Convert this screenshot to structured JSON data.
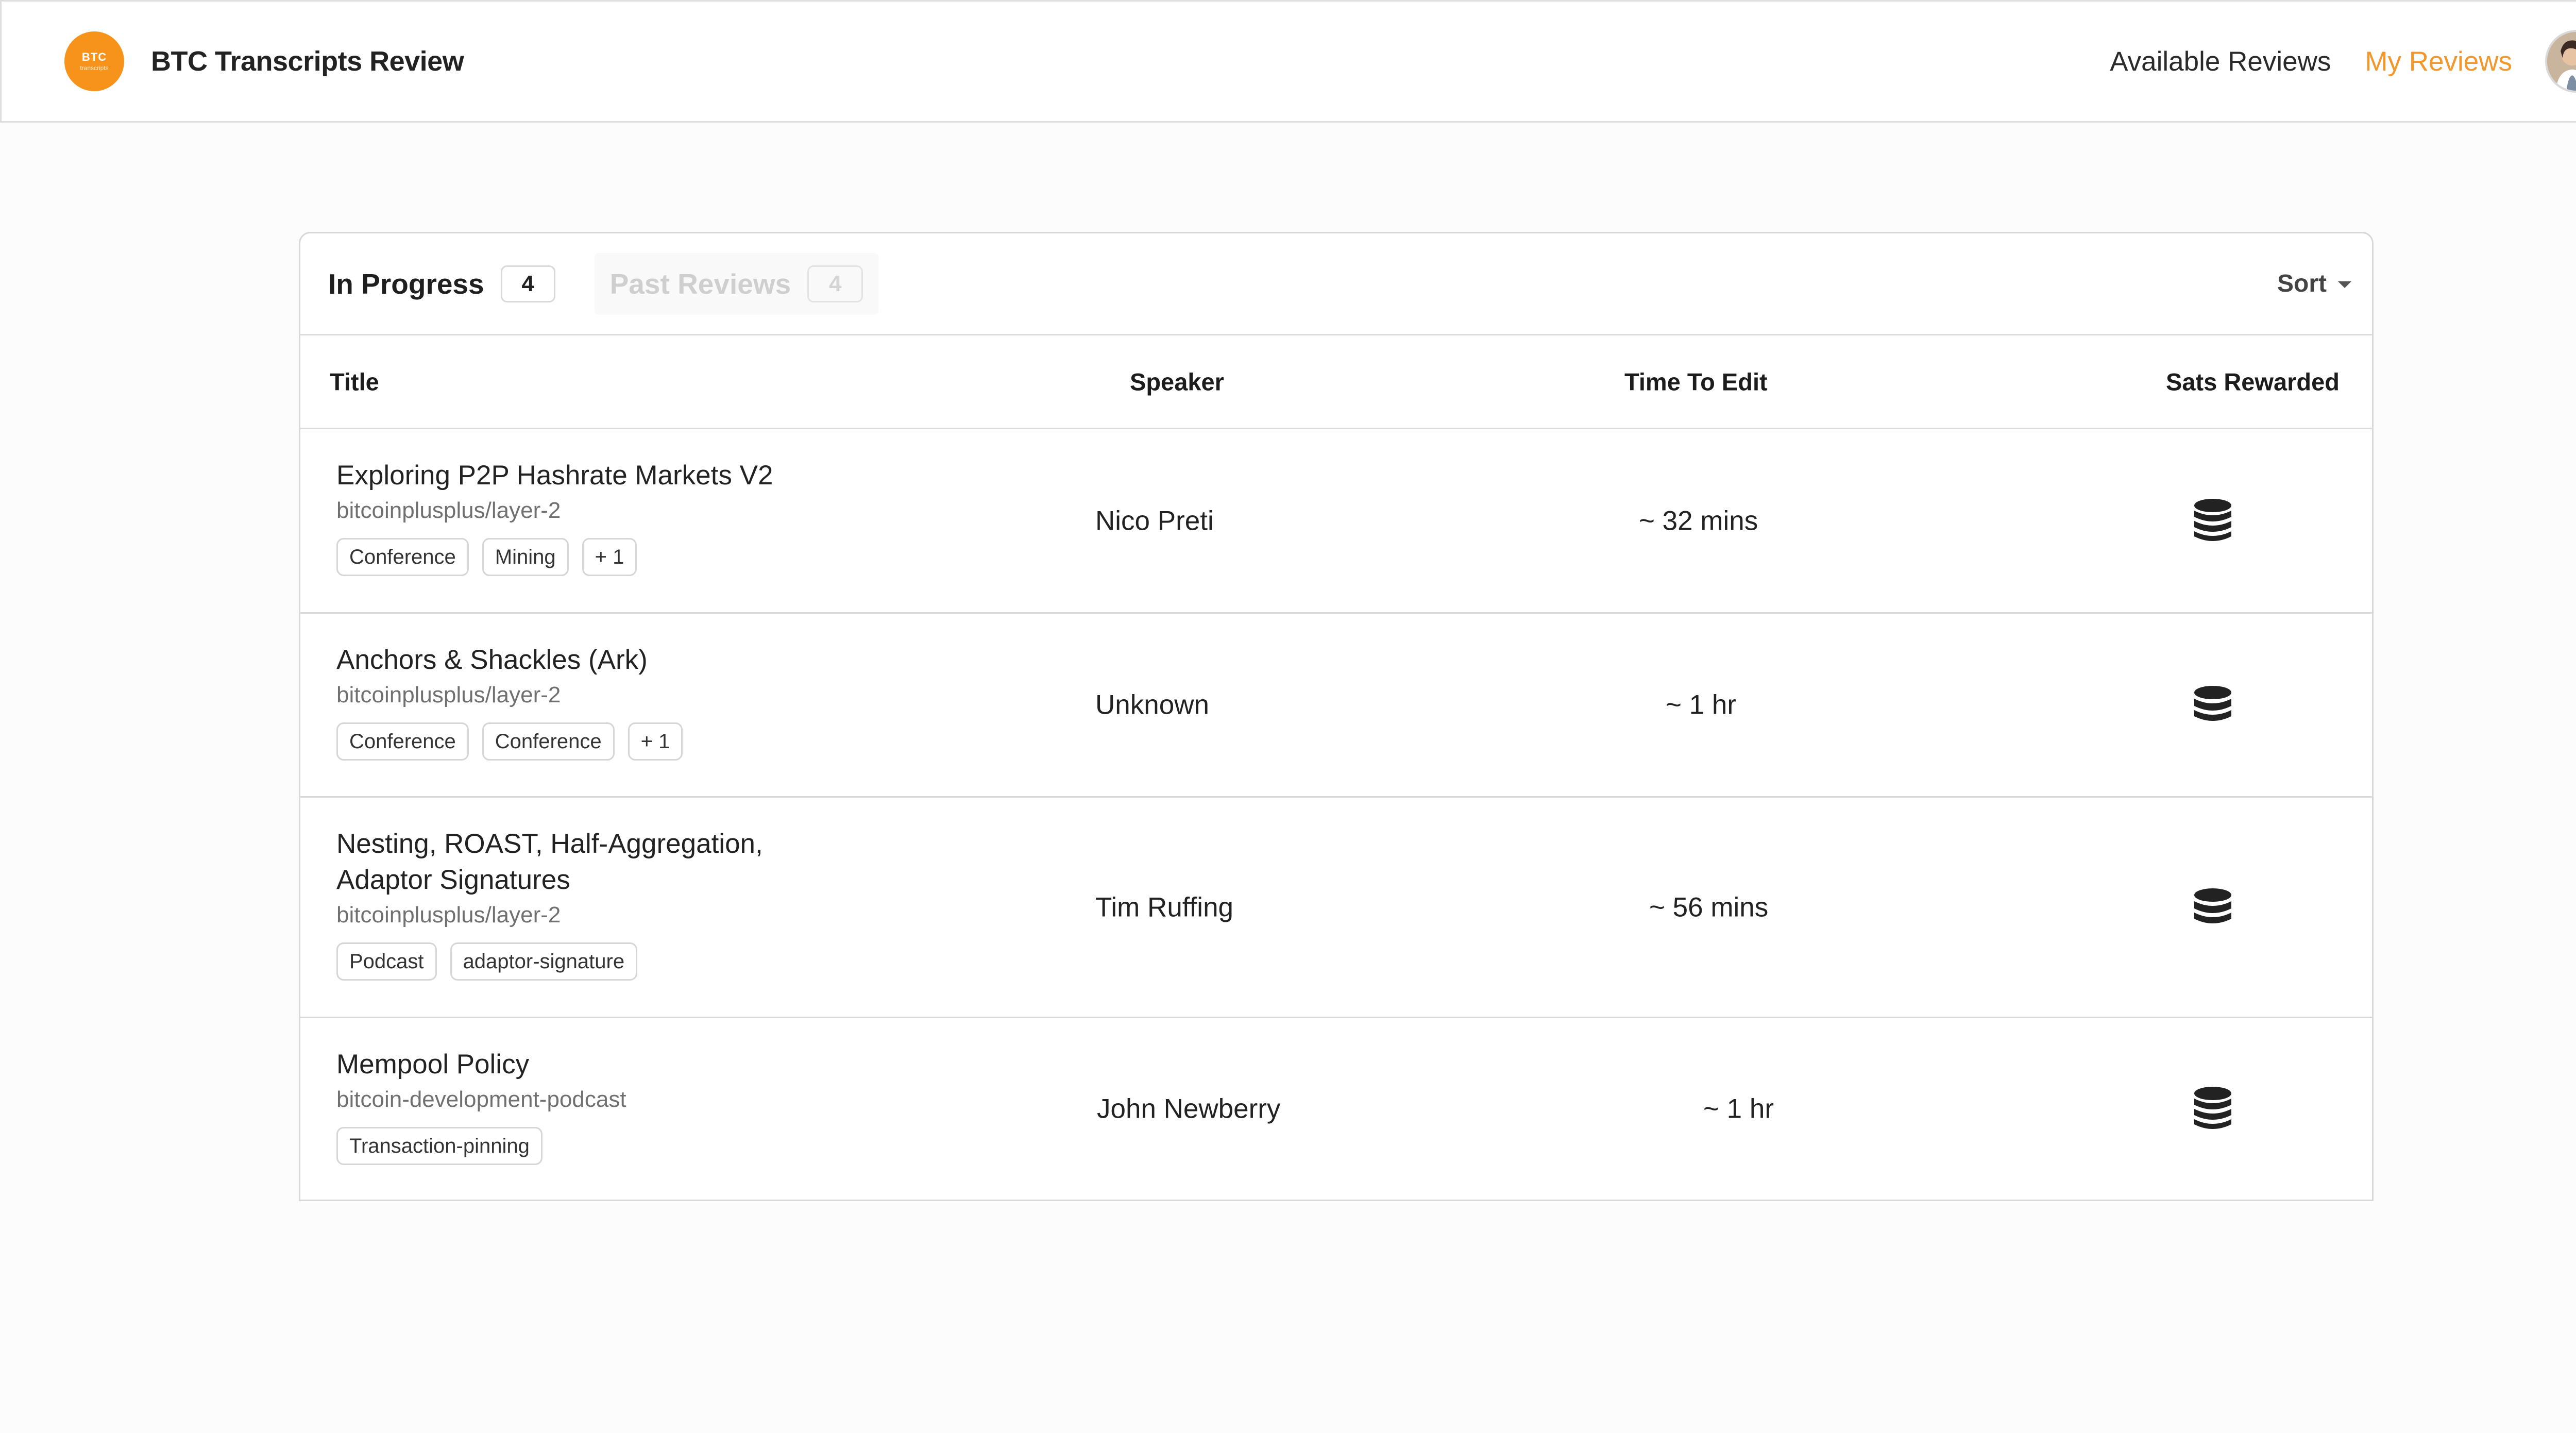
{
  "header": {
    "logo": {
      "line1": "BTC",
      "line2": "transcripts"
    },
    "title": "BTC Transcripts Review",
    "nav": [
      {
        "label": "Available Reviews",
        "active": false
      },
      {
        "label": "My Reviews",
        "active": true
      }
    ],
    "avatar_icon": "user-avatar"
  },
  "colors": {
    "accent": "#f7931a",
    "active_nav": "#f2972c",
    "muted_text": "#707070"
  },
  "tabs": [
    {
      "label": "In Progress",
      "count": "4",
      "active": true
    },
    {
      "label": "Past Reviews",
      "count": "4",
      "active": false
    }
  ],
  "sort": {
    "label": "Sort",
    "icon": "caret-down-icon"
  },
  "table": {
    "columns": {
      "title": "Title",
      "speaker": "Speaker",
      "time": "Time To Edit",
      "sats": "Sats Rewarded"
    },
    "rows": [
      {
        "title": "Exploring P2P Hashrate Markets V2",
        "repo": "bitcoinplusplus/layer-2",
        "tags": [
          "Conference",
          "Mining",
          "+ 1"
        ],
        "speaker": "Nico Preti",
        "time": "~ 32 mins",
        "sats_icon": "coin-stack-icon"
      },
      {
        "title": "Anchors & Shackles (Ark)",
        "repo": "bitcoinplusplus/layer-2",
        "tags": [
          "Conference",
          "Conference",
          "+ 1"
        ],
        "speaker": "Unknown",
        "time": "~ 1 hr",
        "sats_icon": "coin-stack-icon"
      },
      {
        "title_lines": [
          "Nesting, ROAST, Half-Aggregation,",
          "Adaptor Signatures"
        ],
        "repo": "bitcoinplusplus/layer-2",
        "tags": [
          "Podcast",
          "adaptor-signature"
        ],
        "speaker": "Tim Ruffing",
        "time": "~ 56 mins",
        "sats_icon": "coin-stack-icon"
      },
      {
        "title": "Mempool Policy",
        "repo": "bitcoin-development-podcast",
        "tags": [
          "Transaction-pinning"
        ],
        "speaker": "John Newberry",
        "time": "~ 1 hr",
        "sats_icon": "coin-stack-icon"
      }
    ]
  }
}
